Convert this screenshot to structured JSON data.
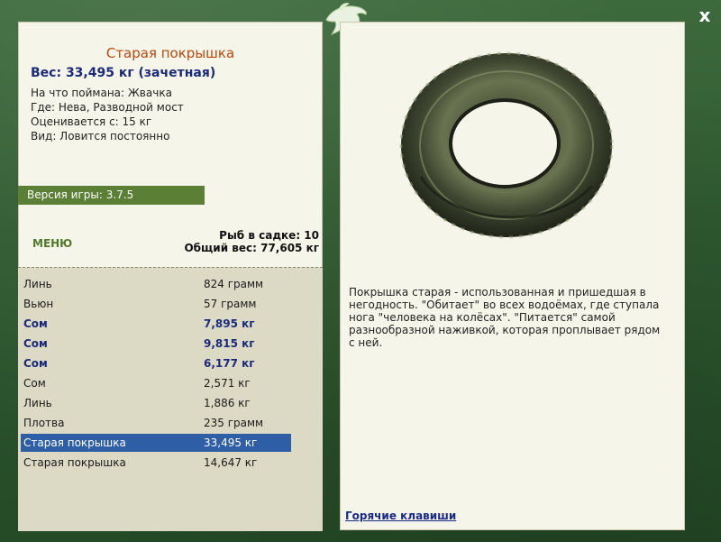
{
  "window": {
    "close_label": "x"
  },
  "fish": {
    "title": "Старая покрышка",
    "weight_line": "Вес: 33,495 кг (зачетная)",
    "caught_on": "На что поймана: Жвачка",
    "location": "Где: Нева, Разводной мост",
    "valued_from": "Оценивается с: 15 кг",
    "kind": "Вид: Ловится постоянно"
  },
  "version": "Версия игры: 3.7.5",
  "menu_label": "МЕНЮ",
  "stats": {
    "fish_count": "Рыб в садке: 10",
    "total_weight": "Общий вес: 77,605 кг"
  },
  "catch_list": [
    {
      "name": "Линь",
      "weight": "824 грамм",
      "style": "normal"
    },
    {
      "name": "Вьюн",
      "weight": "57 грамм",
      "style": "normal"
    },
    {
      "name": "Сом",
      "weight": "7,895 кг",
      "style": "bold"
    },
    {
      "name": "Сом",
      "weight": "9,815 кг",
      "style": "bold"
    },
    {
      "name": "Сом",
      "weight": "6,177 кг",
      "style": "bold"
    },
    {
      "name": "Сом",
      "weight": "2,571 кг",
      "style": "normal"
    },
    {
      "name": "Линь",
      "weight": "1,886 кг",
      "style": "normal"
    },
    {
      "name": "Плотва",
      "weight": "235 грамм",
      "style": "normal"
    },
    {
      "name": "Старая покрышка",
      "weight": "33,495 кг",
      "style": "selected"
    },
    {
      "name": "Старая покрышка",
      "weight": "14,647 кг",
      "style": "normal"
    }
  ],
  "description": {
    "line1": "Покрышка старая - использованная и пришедшая в",
    "line2": "негодность. \"Обитает\" во всех водоёмах, где ступала",
    "line3": "нога \"человека на колёсах\". \"Питается\" самой",
    "line4": "разнообразной наживкой, которая проплывает рядом",
    "line5": "с ней."
  },
  "hotkeys_label": "Горячие клавиши",
  "colors": {
    "frame": "#2f5a30",
    "panel": "#f6f5ea",
    "title": "#b8480d",
    "highlight": "#2e5ea6",
    "bold_text": "#1a2a7a",
    "version_bar": "#5a7f35"
  }
}
